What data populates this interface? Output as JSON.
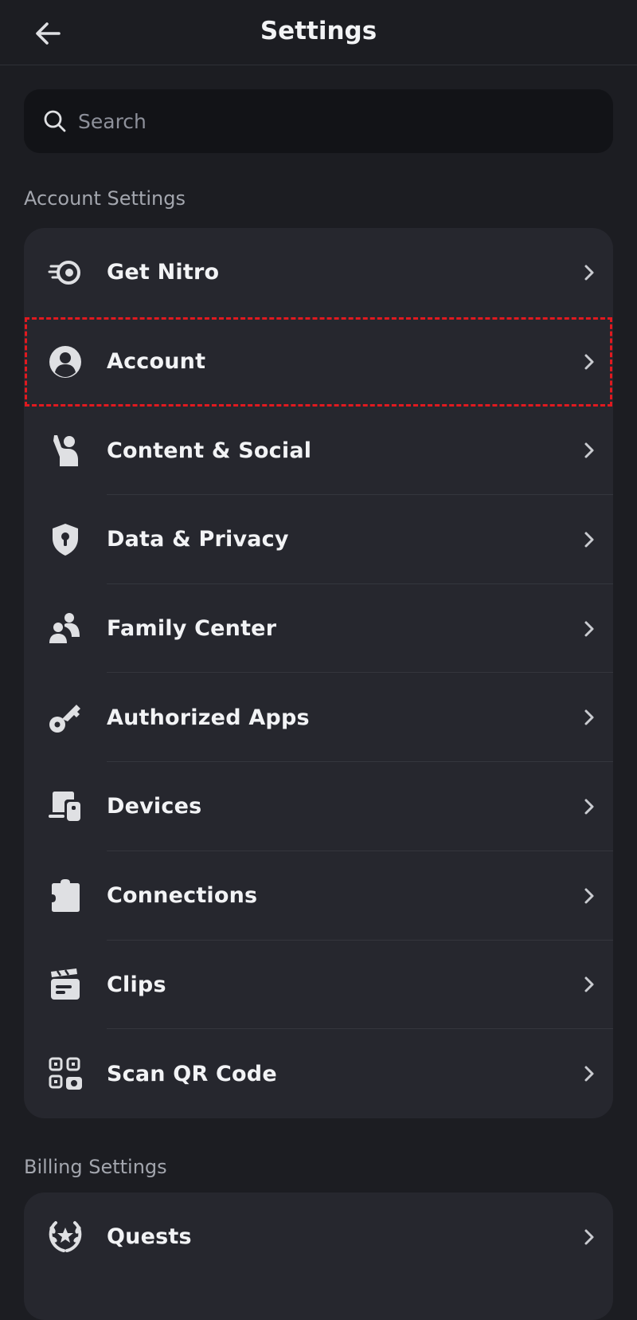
{
  "header": {
    "title": "Settings",
    "back_icon": "arrow-left-icon"
  },
  "search": {
    "placeholder": "Search",
    "value": "",
    "icon": "search-icon"
  },
  "sections": {
    "account": {
      "label": "Account Settings",
      "items": [
        {
          "label": "Get Nitro",
          "icon": "nitro-icon"
        },
        {
          "label": "Account",
          "icon": "user-circle-icon",
          "highlighted": true
        },
        {
          "label": "Content & Social",
          "icon": "waving-person-icon"
        },
        {
          "label": "Data & Privacy",
          "icon": "shield-lock-icon"
        },
        {
          "label": "Family Center",
          "icon": "family-icon"
        },
        {
          "label": "Authorized Apps",
          "icon": "key-icon"
        },
        {
          "label": "Devices",
          "icon": "devices-icon"
        },
        {
          "label": "Connections",
          "icon": "puzzle-icon"
        },
        {
          "label": "Clips",
          "icon": "clapperboard-icon"
        },
        {
          "label": "Scan QR Code",
          "icon": "qr-code-icon"
        }
      ]
    },
    "billing": {
      "label": "Billing Settings",
      "items": [
        {
          "label": "Quests",
          "icon": "laurel-icon"
        }
      ]
    }
  },
  "colors": {
    "background": "#1c1d22",
    "card": "#26272e",
    "search_bg": "#121317",
    "text": "#f2f3f5",
    "muted": "#a3a6ae",
    "highlight": "#e0191f"
  }
}
